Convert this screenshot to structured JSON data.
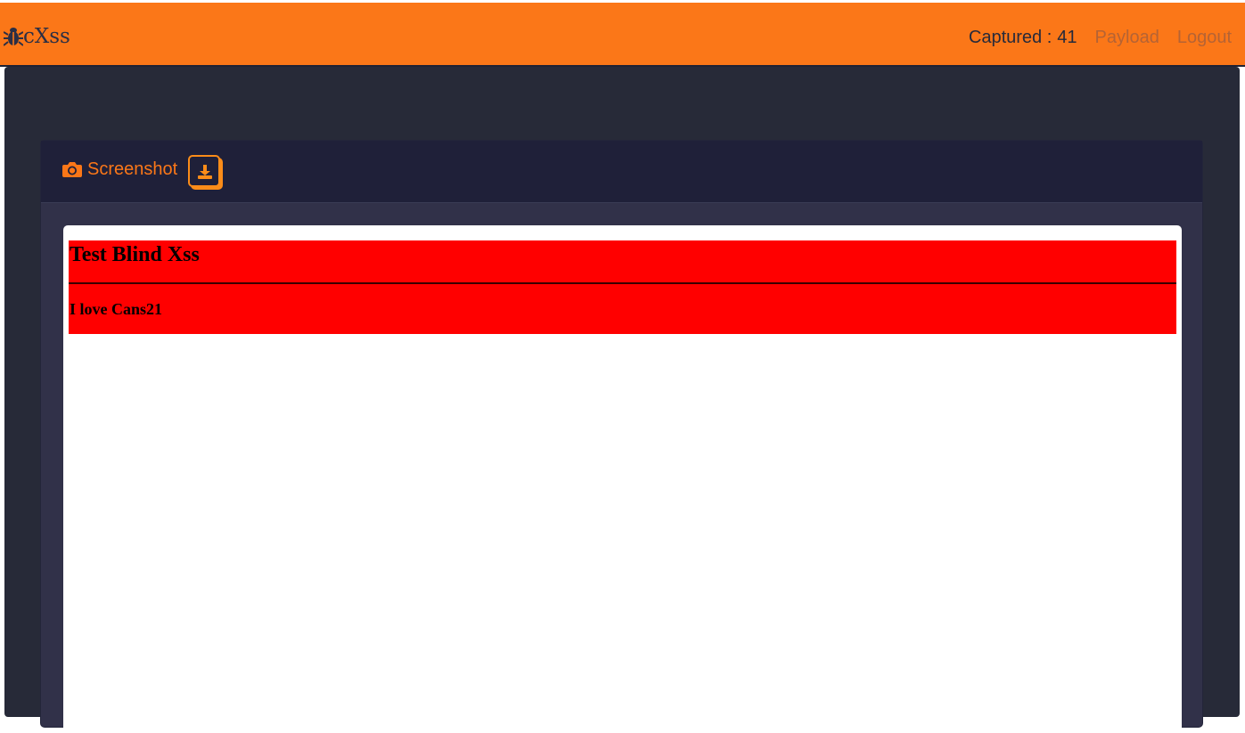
{
  "header": {
    "brand": "cXss",
    "brand_icon": "bug-icon",
    "captured_label": "Captured :",
    "captured_count": "41",
    "nav": {
      "payload": "Payload",
      "logout": "Logout"
    }
  },
  "card": {
    "icon": "camera-icon",
    "title": "Screenshot",
    "download_icon": "download-icon"
  },
  "screenshot": {
    "heading": "Test Blind Xss",
    "subheading": "I love Cans21"
  },
  "colors": {
    "accent": "#fb7718",
    "background": "#272a38",
    "card_header": "#1f2039",
    "card_body": "#313149",
    "banner": "#ff0000"
  }
}
